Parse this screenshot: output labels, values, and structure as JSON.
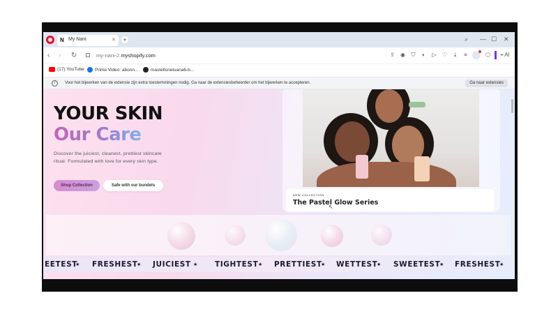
{
  "browser": {
    "tab_title": "My Nani",
    "tab_favicon": "N",
    "url_prefix": "my-nani-2.",
    "url_domain": "myshopify.com",
    "ai_label": "AI"
  },
  "bookmarks": [
    {
      "label": "(17) YouTube",
      "icon": "youtube-icon"
    },
    {
      "label": "Prime Video: abonn...",
      "icon": "prime-video-icon"
    },
    {
      "label": "mastelloneluana6-b...",
      "icon": "github-icon"
    }
  ],
  "infobar": {
    "message": "Voor het bijwerken van de extensie zijn extra toestemmingen nodig. Ga naar de extensiesbeheerder om het bijwerken te accepteren.",
    "button": "Ga naar extensies"
  },
  "hero": {
    "title": "YOUR SKIN",
    "subtitle": "Our Care",
    "description": "Discover the juiciest, cleanest, prettiest skincare ritual. Formulated with love for every skin type.",
    "primary_button": "Shop Collection",
    "secondary_button": "Safe with our bundels"
  },
  "featured": {
    "kicker": "NEW COLLECTION",
    "title": "The Pastel Glow Series"
  },
  "ticker": [
    "EETEST",
    "FRESHEST",
    "JUICIEST",
    "TIGHTEST",
    "PRETTIEST",
    "WETTEST",
    "SWEETEST",
    "FRESHEST"
  ],
  "colors": {
    "opera_red": "#e3132b",
    "accent_purple": "#7b2ff7",
    "hero_gradient_start": "#c266b8",
    "hero_gradient_end": "#7fb4e8"
  }
}
